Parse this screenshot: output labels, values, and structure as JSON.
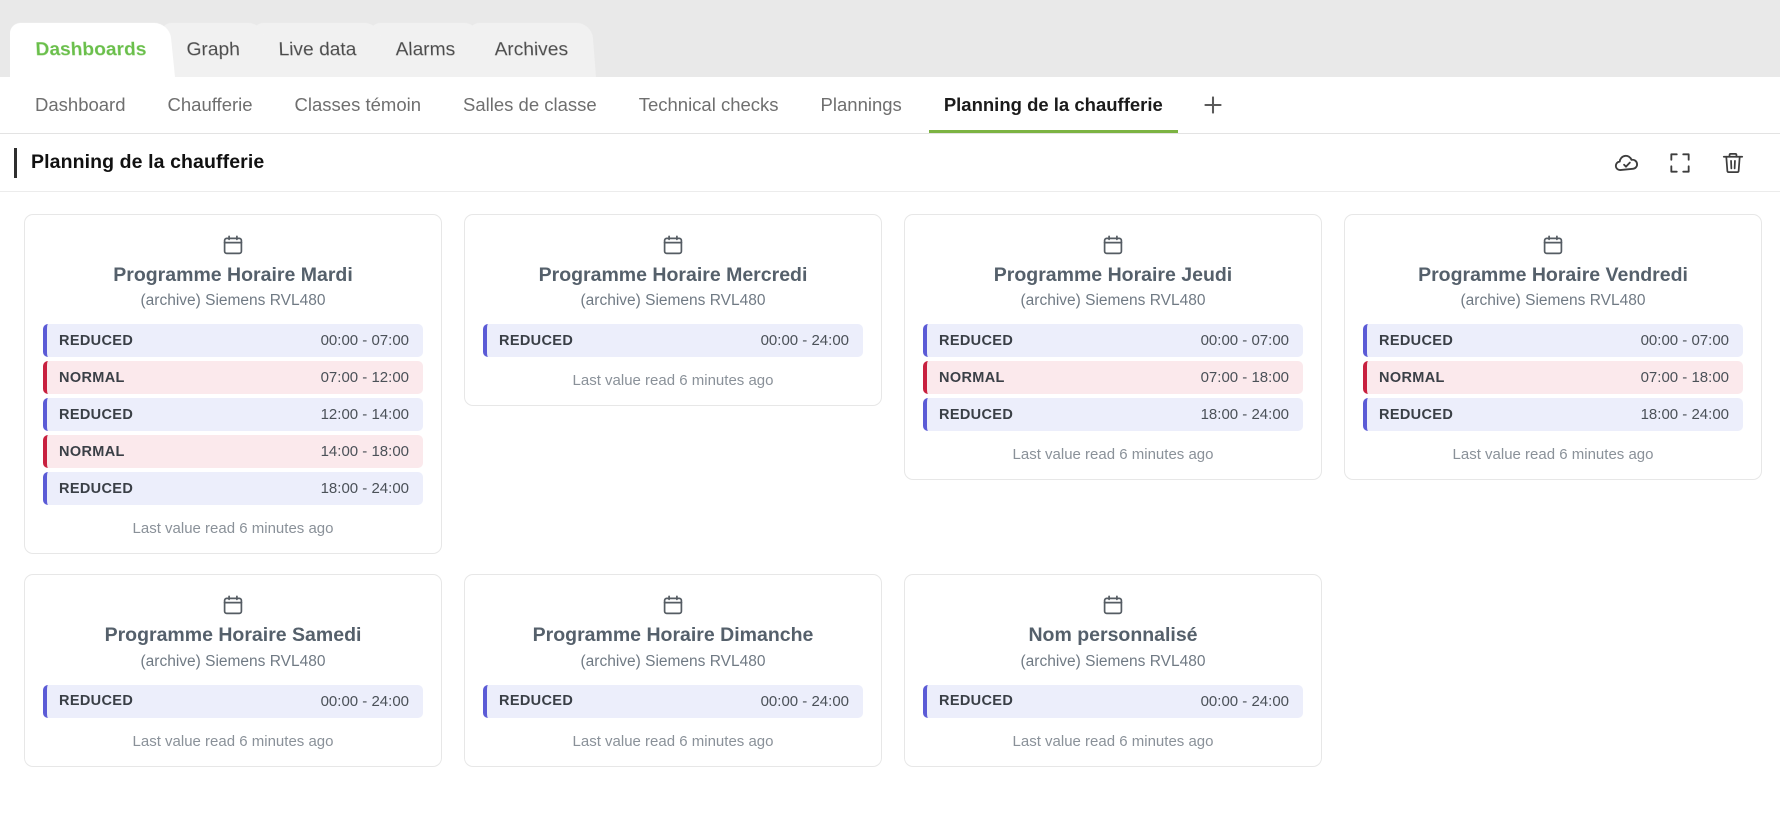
{
  "top_tabs": [
    {
      "label": "Dashboards",
      "active": true
    },
    {
      "label": "Graph",
      "active": false
    },
    {
      "label": "Live data",
      "active": false
    },
    {
      "label": "Alarms",
      "active": false
    },
    {
      "label": "Archives",
      "active": false
    }
  ],
  "sub_tabs": [
    {
      "label": "Dashboard",
      "active": false
    },
    {
      "label": "Chaufferie",
      "active": false
    },
    {
      "label": "Classes témoin",
      "active": false
    },
    {
      "label": "Salles de classe",
      "active": false
    },
    {
      "label": "Technical checks",
      "active": false
    },
    {
      "label": "Plannings",
      "active": false
    },
    {
      "label": "Planning de la chaufferie",
      "active": true
    }
  ],
  "add_tab": {
    "icon": "plus-icon"
  },
  "header": {
    "title": "Planning de la chaufferie",
    "actions": [
      {
        "name": "cloud-check-icon",
        "tooltip": "Saved"
      },
      {
        "name": "fullscreen-icon",
        "tooltip": "Fullscreen"
      },
      {
        "name": "trash-icon",
        "tooltip": "Delete"
      }
    ]
  },
  "accent_colors": {
    "brand_green": "#6abf4b",
    "active_underline": "#7cb342",
    "reduced_bg": "#eceefb",
    "reduced_border": "#5b5bd6",
    "normal_bg": "#fbe9ec",
    "normal_border": "#c8203f"
  },
  "cards": [
    {
      "icon": "calendar-icon",
      "title": "Programme Horaire Mardi",
      "subtitle": "(archive) Siemens RVL480",
      "rows": [
        {
          "state": "REDUCED",
          "mode": "reduced",
          "time": "00:00 - 07:00"
        },
        {
          "state": "NORMAL",
          "mode": "normal",
          "time": "07:00 - 12:00"
        },
        {
          "state": "REDUCED",
          "mode": "reduced",
          "time": "12:00 - 14:00"
        },
        {
          "state": "NORMAL",
          "mode": "normal",
          "time": "14:00 - 18:00"
        },
        {
          "state": "REDUCED",
          "mode": "reduced",
          "time": "18:00 - 24:00"
        }
      ],
      "footer": "Last value read 6 minutes ago"
    },
    {
      "icon": "calendar-icon",
      "title": "Programme Horaire Mercredi",
      "subtitle": "(archive) Siemens RVL480",
      "rows": [
        {
          "state": "REDUCED",
          "mode": "reduced",
          "time": "00:00 - 24:00"
        }
      ],
      "footer": "Last value read 6 minutes ago"
    },
    {
      "icon": "calendar-icon",
      "title": "Programme Horaire Jeudi",
      "subtitle": "(archive) Siemens RVL480",
      "rows": [
        {
          "state": "REDUCED",
          "mode": "reduced",
          "time": "00:00 - 07:00"
        },
        {
          "state": "NORMAL",
          "mode": "normal",
          "time": "07:00 - 18:00"
        },
        {
          "state": "REDUCED",
          "mode": "reduced",
          "time": "18:00 - 24:00"
        }
      ],
      "footer": "Last value read 6 minutes ago"
    },
    {
      "icon": "calendar-icon",
      "title": "Programme Horaire Vendredi",
      "subtitle": "(archive) Siemens RVL480",
      "rows": [
        {
          "state": "REDUCED",
          "mode": "reduced",
          "time": "00:00 - 07:00"
        },
        {
          "state": "NORMAL",
          "mode": "normal",
          "time": "07:00 - 18:00"
        },
        {
          "state": "REDUCED",
          "mode": "reduced",
          "time": "18:00 - 24:00"
        }
      ],
      "footer": "Last value read 6 minutes ago"
    },
    {
      "icon": "calendar-icon",
      "title": "Programme Horaire Samedi",
      "subtitle": "(archive) Siemens RVL480",
      "rows": [
        {
          "state": "REDUCED",
          "mode": "reduced",
          "time": "00:00 - 24:00"
        }
      ],
      "footer": "Last value read 6 minutes ago"
    },
    {
      "icon": "calendar-icon",
      "title": "Programme Horaire Dimanche",
      "subtitle": "(archive) Siemens RVL480",
      "rows": [
        {
          "state": "REDUCED",
          "mode": "reduced",
          "time": "00:00 - 24:00"
        }
      ],
      "footer": "Last value read 6 minutes ago"
    },
    {
      "icon": "calendar-icon",
      "title": "Nom personnalisé",
      "subtitle": "(archive) Siemens RVL480",
      "rows": [
        {
          "state": "REDUCED",
          "mode": "reduced",
          "time": "00:00 - 24:00"
        }
      ],
      "footer": "Last value read 6 minutes ago"
    }
  ]
}
